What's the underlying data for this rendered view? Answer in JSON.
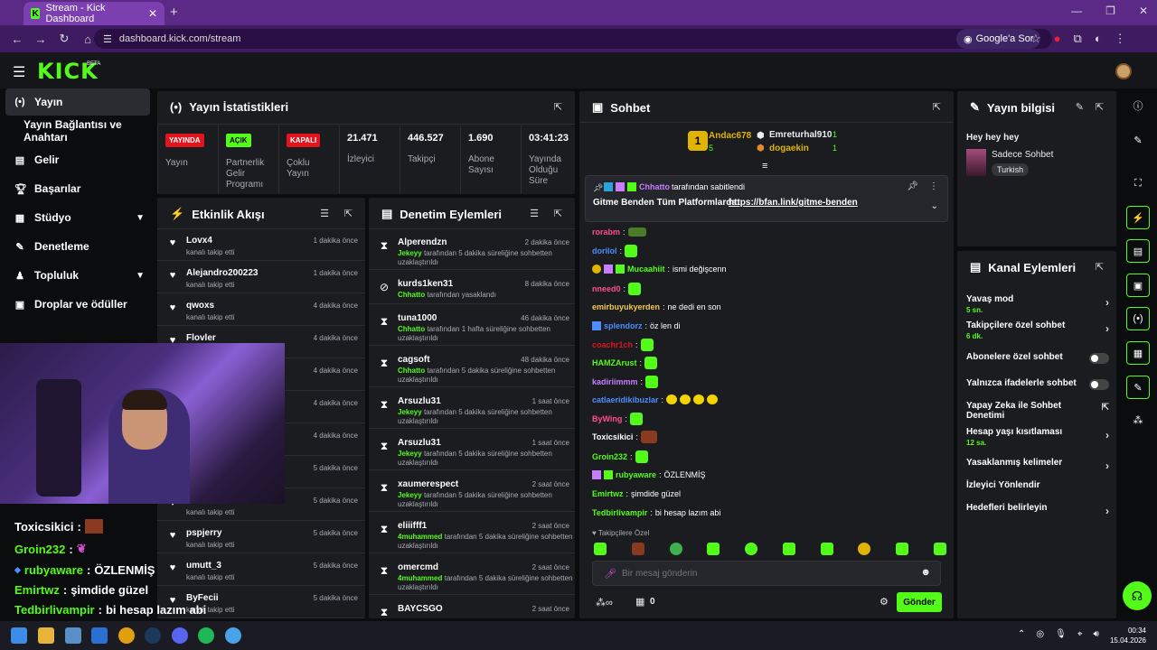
{
  "browser": {
    "tab_title": "Stream - Kick Dashboard",
    "url": "dashboard.kick.com/stream",
    "google_label": "Google'a Sor"
  },
  "header": {
    "logo": "KICK",
    "beta": "BETA"
  },
  "sidebar": {
    "items": [
      {
        "label": "Yayın",
        "icon": "broadcast-icon",
        "active": true
      },
      {
        "label": "Yayın Bağlantısı ve Anahtarı",
        "icon": "",
        "active": false
      },
      {
        "label": "Gelir",
        "icon": "chart-icon",
        "active": false
      },
      {
        "label": "Başarılar",
        "icon": "trophy-icon",
        "active": false
      },
      {
        "label": "Stüdyo",
        "icon": "studio-icon",
        "active": false,
        "expandable": true
      },
      {
        "label": "Denetleme",
        "icon": "wrench-icon",
        "active": false
      },
      {
        "label": "Topluluk",
        "icon": "community-icon",
        "active": false,
        "expandable": true
      },
      {
        "label": "Droplar ve ödüller",
        "icon": "gift-icon",
        "active": false
      }
    ]
  },
  "overlay_chat": [
    {
      "user": "Toxicsikici",
      "sep": ":",
      "text": ""
    },
    {
      "user": "Groin232",
      "sep": ":",
      "text": ""
    },
    {
      "user": "rubyaware",
      "sep": ":",
      "text": "ÖZLENMİŞ"
    },
    {
      "user": "Emirtwz",
      "sep": ":",
      "text": "şimdide güzel"
    },
    {
      "user": "Tedbirlivampir",
      "sep": ":",
      "text": "bi hesap lazım abi"
    }
  ],
  "stats": {
    "title": "Yayın İstatistikleri",
    "items": [
      {
        "badge": "YAYINDA",
        "badge_color": "#e0151e",
        "label": "Yayın"
      },
      {
        "badge": "AÇIK",
        "badge_color": "#53fc18",
        "label": "Partnerlik Gelir Programı"
      },
      {
        "badge": "KAPALI",
        "badge_color": "#e0151e",
        "label": "Çoklu Yayın"
      },
      {
        "value": "21.471",
        "label": "İzleyici"
      },
      {
        "value": "446.527",
        "label": "Takipçi"
      },
      {
        "value": "1.690",
        "label": "Abone Sayısı"
      },
      {
        "value": "03:41:23",
        "label": "Yayında Olduğu Süre"
      }
    ]
  },
  "activity": {
    "title": "Etkinlik Akışı",
    "rows": [
      {
        "name": "Lovx4",
        "sub": "kanalı takip etti",
        "time": "1 dakika önce"
      },
      {
        "name": "Alejandro200223",
        "sub": "kanalı takip etti",
        "time": "1 dakika önce"
      },
      {
        "name": "qwoxs",
        "sub": "kanalı takip etti",
        "time": "4 dakika önce"
      },
      {
        "name": "Flovler",
        "sub": "",
        "time": "4 dakika önce"
      },
      {
        "name": "",
        "sub": "",
        "time": "4 dakika önce"
      },
      {
        "name": "",
        "sub": "",
        "time": "4 dakika önce"
      },
      {
        "name": "",
        "sub": "",
        "time": "4 dakika önce"
      },
      {
        "name": "",
        "sub": "",
        "time": "5 dakika önce"
      },
      {
        "name": "",
        "sub": "kanalı takip etti",
        "time": "5 dakika önce"
      },
      {
        "name": "pspjerry",
        "sub": "kanalı takip etti",
        "time": "5 dakika önce"
      },
      {
        "name": "umutt_3",
        "sub": "kanalı takip etti",
        "time": "5 dakika önce"
      },
      {
        "name": "ByFecii",
        "sub": "kanalı takip etti",
        "time": "5 dakika önce"
      }
    ]
  },
  "moderation": {
    "title": "Denetim Eylemleri",
    "rows": [
      {
        "icon": "hourglass-icon",
        "name": "Alperendzn",
        "mod": "Jekeyy",
        "desc": "tarafından 5 dakika süreliğine sohbetten uzaklaştırıldı",
        "time": "2 dakika önce"
      },
      {
        "icon": "ban-icon",
        "name": "kurds1ken31",
        "mod": "Chhatto",
        "desc": "tarafından yasaklandı",
        "time": "8 dakika önce"
      },
      {
        "icon": "hourglass-icon",
        "name": "tuna1000",
        "mod": "Chhatto",
        "desc": "tarafından 1 hafta süreliğine sohbetten uzaklaştırıldı",
        "time": "46 dakika önce"
      },
      {
        "icon": "hourglass-icon",
        "name": "cagsoft",
        "mod": "Chhatto",
        "desc": "tarafından 5 dakika süreliğine sohbetten uzaklaştırıldı",
        "time": "48 dakika önce"
      },
      {
        "icon": "hourglass-icon",
        "name": "Arsuzlu31",
        "mod": "Jekeyy",
        "desc": "tarafından 5 dakika süreliğine sohbetten uzaklaştırıldı",
        "time": "1 saat önce"
      },
      {
        "icon": "hourglass-icon",
        "name": "Arsuzlu31",
        "mod": "Jekeyy",
        "desc": "tarafından 5 dakika süreliğine sohbetten uzaklaştırıldı",
        "time": "1 saat önce"
      },
      {
        "icon": "hourglass-icon",
        "name": "xaumerespect",
        "mod": "Jekeyy",
        "desc": "tarafından 5 dakika süreliğine sohbetten uzaklaştırıldı",
        "time": "2 saat önce"
      },
      {
        "icon": "hourglass-icon",
        "name": "eliiifff1",
        "mod": "4muhammed",
        "desc": "tarafından 5 dakika süreliğine sohbetten uzaklaştırıldı",
        "time": "2 saat önce"
      },
      {
        "icon": "hourglass-icon",
        "name": "omercmd",
        "mod": "4muhammed",
        "desc": "tarafından 5 dakika süreliğine sohbetten uzaklaştırıldı",
        "time": "2 saat önce"
      },
      {
        "icon": "hourglass-icon",
        "name": "BAYCSGO",
        "mod": "",
        "desc": "",
        "time": "2 saat önce"
      }
    ]
  },
  "chat": {
    "title": "Sohbet",
    "leaderboard": [
      {
        "rank": "1",
        "user": "Andac678",
        "count": "5"
      },
      {
        "user": "Emreturhal910",
        "count": "1"
      },
      {
        "user": "dogaekin",
        "count": "1"
      }
    ],
    "pinned": {
      "by": "Chhatto",
      "by_suffix": "tarafından sabitlendi",
      "text": "Gitme Benden Tüm Platformlarda:",
      "link": "https://bfan.link/gitme-benden"
    },
    "messages": [
      {
        "user": "rorabm",
        "color": "#ff4d8d",
        "text": "",
        "emotes": 1
      },
      {
        "user": "dorilol",
        "color": "#4d8dff",
        "text": "",
        "emotes": 1
      },
      {
        "user": "Mucaahiit",
        "color": "#53fc18",
        "text": "ismi değişcenn",
        "emotes": 0
      },
      {
        "user": "nneed0",
        "color": "#ff4d8d",
        "text": "",
        "emotes": 1
      },
      {
        "user": "emirbuyukyerden",
        "color": "#f2c94c",
        "text": "ne dedi en son",
        "emotes": 0
      },
      {
        "user": "splendorz",
        "color": "#4d8dff",
        "text": "öz len di",
        "emotes": 0
      },
      {
        "user": "coachr1ch",
        "color": "#e0151e",
        "text": "",
        "emotes": 1
      },
      {
        "user": "HAMZArust",
        "color": "#53fc18",
        "text": "",
        "emotes": 1
      },
      {
        "user": "kadiriimmm",
        "color": "#c77dff",
        "text": "",
        "emotes": 1
      },
      {
        "user": "catlaeridikibuzlar",
        "color": "#4d8dff",
        "text": "",
        "emotes": 0,
        "hearts": 4
      },
      {
        "user": "ByWing",
        "color": "#ff4d8d",
        "text": "",
        "emotes": 1
      },
      {
        "user": "Toxicsikici",
        "color": "#fff",
        "text": "",
        "emotes": 1
      },
      {
        "user": "Groin232",
        "color": "#53fc18",
        "text": "",
        "emotes": 1
      },
      {
        "user": "rubyaware",
        "color": "#53fc18",
        "text": "ÖZLENMİŞ",
        "emotes": 0
      },
      {
        "user": "Emirtwz",
        "color": "#53fc18",
        "text": "şimdide güzel",
        "emotes": 0
      },
      {
        "user": "Tedbirlivampir",
        "color": "#53fc18",
        "text": "bi hesap lazım abi",
        "emotes": 0
      }
    ],
    "followers_only": "Takipçilere Özel",
    "input_placeholder": "Bir mesaj gönderin",
    "points": "0",
    "send_label": "Gönder"
  },
  "stream_info": {
    "title": "Yayın bilgisi",
    "stream_title": "Hey hey hey",
    "category": "Sadece Sohbet",
    "tag": "Turkish"
  },
  "channel_actions": {
    "title": "Kanal Eylemleri",
    "items": [
      {
        "label": "Yavaş mod",
        "sub": "5 sn.",
        "control": "arrow"
      },
      {
        "label": "Takipçilere özel sohbet",
        "sub": "6 dk.",
        "control": "arrow"
      },
      {
        "label": "Abonelere özel sohbet",
        "sub": "",
        "control": "toggle"
      },
      {
        "label": "Yalnızca ifadelerle sohbet",
        "sub": "",
        "control": "toggle"
      },
      {
        "label": "Yapay Zeka ile Sohbet Denetimi",
        "sub": "",
        "control": "external"
      },
      {
        "label": "Hesap yaşı kısıtlaması",
        "sub": "12 sa.",
        "control": "arrow"
      },
      {
        "label": "Yasaklanmış kelimeler",
        "sub": "",
        "control": "arrow"
      },
      {
        "label": "İzleyici Yönlendir",
        "sub": "",
        "control": "none"
      },
      {
        "label": "Hedefleri belirleyin",
        "sub": "",
        "control": "arrow"
      }
    ]
  },
  "taskbar": {
    "time": "00:34",
    "date": "15.04.2026"
  }
}
